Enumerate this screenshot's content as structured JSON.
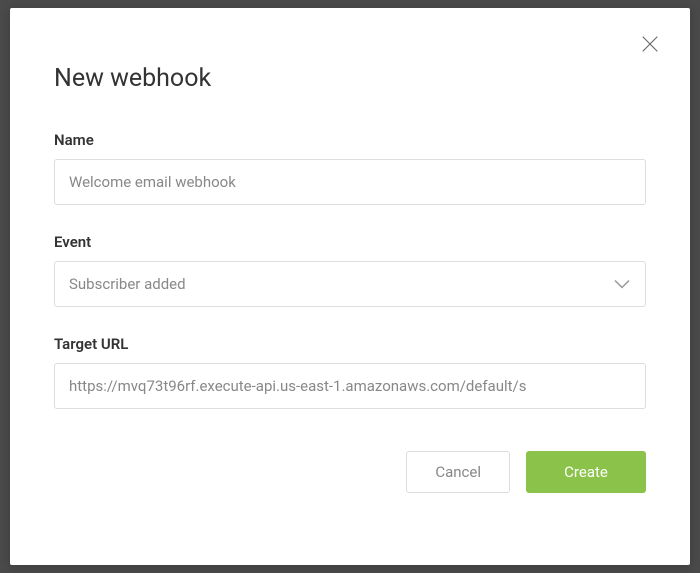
{
  "modal": {
    "title": "New webhook",
    "fields": {
      "name": {
        "label": "Name",
        "value": "Welcome email webhook"
      },
      "event": {
        "label": "Event",
        "value": "Subscriber added"
      },
      "target_url": {
        "label": "Target URL",
        "value": "https://mvq73t96rf.execute-api.us-east-1.amazonaws.com/default/s"
      }
    },
    "buttons": {
      "cancel": "Cancel",
      "create": "Create"
    }
  }
}
